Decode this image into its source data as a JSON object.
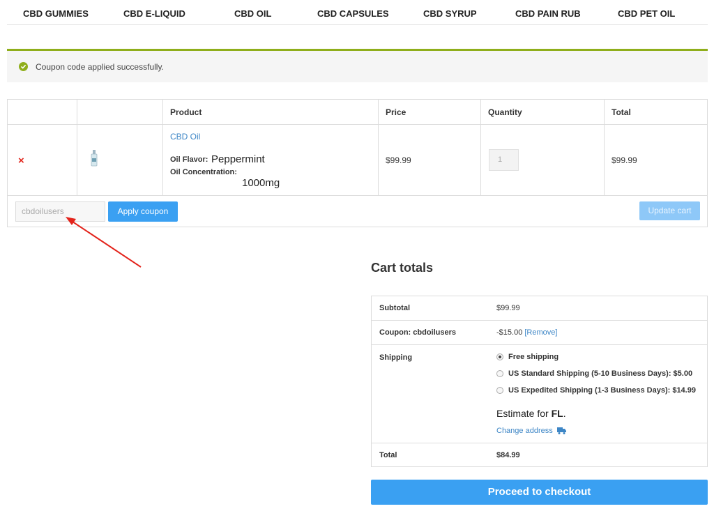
{
  "nav": {
    "items": [
      "CBD GUMMIES",
      "CBD E-LIQUID",
      "CBD OIL",
      "CBD CAPSULES",
      "CBD SYRUP",
      "CBD PAIN RUB",
      "CBD PET OIL"
    ]
  },
  "notice": {
    "message": "Coupon code applied successfully."
  },
  "cart": {
    "headers": {
      "product": "Product",
      "price": "Price",
      "quantity": "Quantity",
      "total": "Total"
    },
    "remove_symbol": "×",
    "item": {
      "name": "CBD Oil",
      "flavor_label": "Oil Flavor:",
      "flavor_value": "Peppermint",
      "concentration_label": "Oil Concentration:",
      "concentration_value": "1000mg",
      "price": "$99.99",
      "quantity": "1",
      "total": "$99.99"
    },
    "coupon_value": "cbdoilusers",
    "apply_label": "Apply coupon",
    "update_label": "Update cart"
  },
  "totals": {
    "title": "Cart totals",
    "subtotal_label": "Subtotal",
    "subtotal_value": "$99.99",
    "coupon_label": "Coupon: cbdoilusers",
    "coupon_value": "-$15.00",
    "coupon_remove": "[Remove]",
    "shipping_label": "Shipping",
    "shipping_options": [
      "Free shipping",
      "US Standard Shipping (5-10 Business Days): $5.00",
      "US Expedited Shipping (1-3 Business Days): $14.99"
    ],
    "estimate_prefix": "Estimate for",
    "estimate_state": "FL",
    "estimate_suffix": ".",
    "change_address": "Change address",
    "total_label": "Total",
    "total_value": "$84.99",
    "checkout_label": "Proceed to checkout"
  },
  "colors": {
    "accent": "#3aa0f2",
    "success": "#8fae1b",
    "remove": "#e2231a",
    "link": "#3d86c6"
  }
}
